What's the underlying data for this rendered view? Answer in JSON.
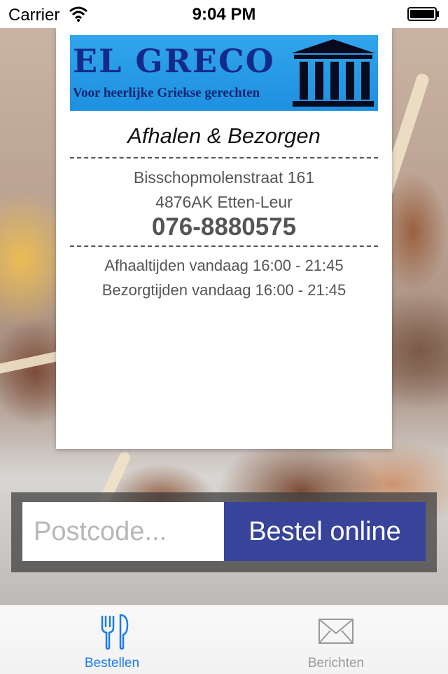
{
  "status_bar": {
    "carrier": "Carrier",
    "time": "9:04 PM"
  },
  "logo": {
    "name": "EL GRECO",
    "tagline": "Voor heerlijke Griekse gerechten"
  },
  "receipt": {
    "subtitle": "Afhalen & Bezorgen",
    "street": "Bisschopmolenstraat 161",
    "postal_city": "4876AK Etten-Leur",
    "phone": "076-8880575",
    "pickup_hours": "Afhaaltijden vandaag 16:00 - 21:45",
    "delivery_hours": "Bezorgtijden vandaag 16:00 - 21:45"
  },
  "order": {
    "postcode_placeholder": "Postcode...",
    "postcode_value": "",
    "button_label": "Bestel online"
  },
  "tabs": [
    {
      "label": "Bestellen",
      "icon": "fork-knife-icon",
      "active": true
    },
    {
      "label": "Berichten",
      "icon": "envelope-icon",
      "active": false
    }
  ],
  "colors": {
    "accent": "#1b7bea",
    "order_button": "#37449a",
    "logo_background": "#1e90e0",
    "logo_text": "#132a8a"
  }
}
